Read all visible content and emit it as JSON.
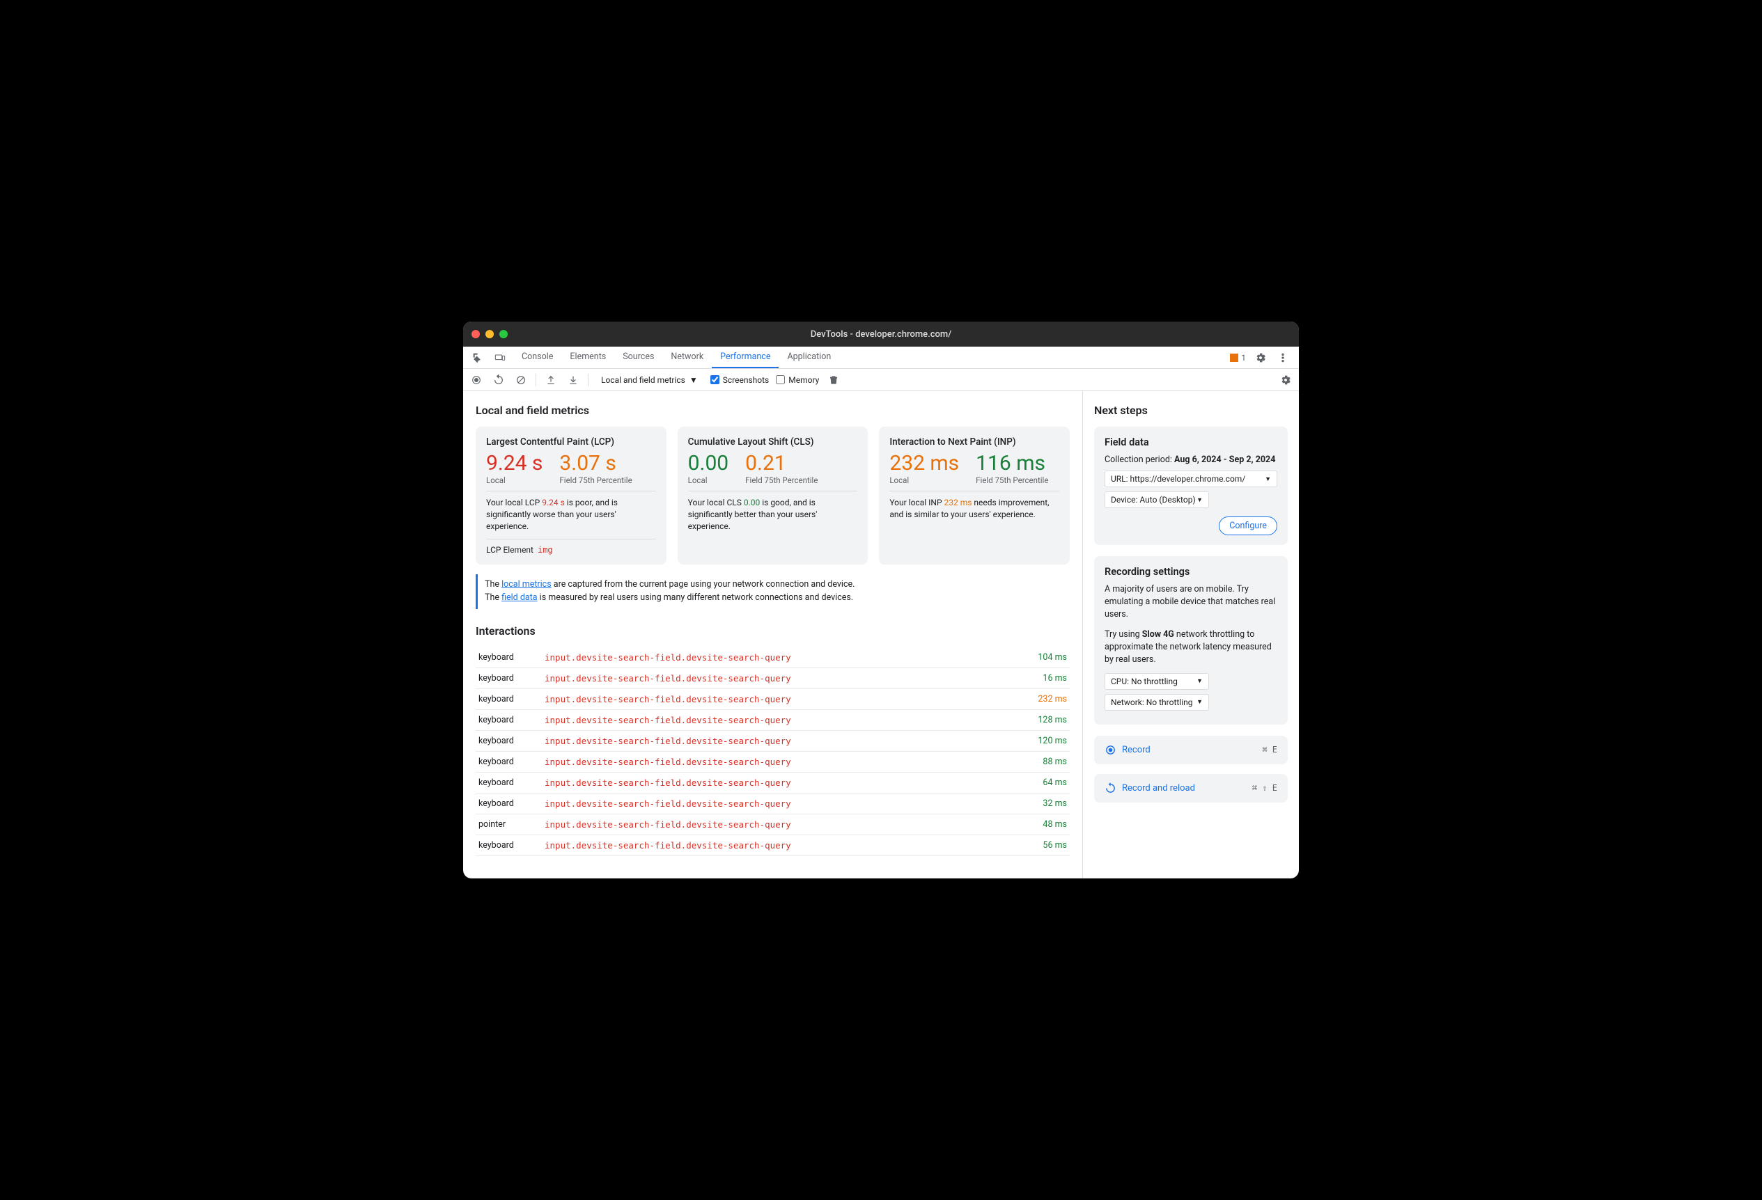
{
  "window": {
    "title": "DevTools - developer.chrome.com/"
  },
  "tabs": [
    "Console",
    "Elements",
    "Sources",
    "Network",
    "Performance",
    "Application"
  ],
  "active_tab": "Performance",
  "issues_count": "1",
  "toolbar": {
    "dropdown": "Local and field metrics",
    "screenshots": "Screenshots",
    "memory": "Memory"
  },
  "main": {
    "heading": "Local and field metrics",
    "cards": [
      {
        "title": "Largest Contentful Paint (LCP)",
        "local_value": "9.24 s",
        "local_class": "red",
        "field_value": "3.07 s",
        "field_class": "orange",
        "local_label": "Local",
        "field_label": "Field 75th Percentile",
        "text_pre": "Your local LCP ",
        "text_val": "9.24 s",
        "text_val_class": "red",
        "text_post": " is poor, and is significantly worse than your users' experience.",
        "lcp_label": "LCP Element",
        "lcp_tag": "img"
      },
      {
        "title": "Cumulative Layout Shift (CLS)",
        "local_value": "0.00",
        "local_class": "green",
        "field_value": "0.21",
        "field_class": "orange",
        "local_label": "Local",
        "field_label": "Field 75th Percentile",
        "text_pre": "Your local CLS ",
        "text_val": "0.00",
        "text_val_class": "green",
        "text_post": " is good, and is significantly better than your users' experience."
      },
      {
        "title": "Interaction to Next Paint (INP)",
        "local_value": "232 ms",
        "local_class": "orange",
        "field_value": "116 ms",
        "field_class": "green",
        "local_label": "Local",
        "field_label": "Field 75th Percentile",
        "text_pre": "Your local INP ",
        "text_val": "232 ms",
        "text_val_class": "orange",
        "text_post": " needs improvement, and is similar to your users' experience."
      }
    ],
    "info": {
      "l1a": "The ",
      "l1link": "local metrics",
      "l1b": " are captured from the current page using your network connection and device.",
      "l2a": "The ",
      "l2link": "field data",
      "l2b": " is measured by real users using many different network connections and devices."
    },
    "interactions_heading": "Interactions",
    "interactions": [
      {
        "type": "keyboard",
        "selector": "input.devsite-search-field.devsite-search-query",
        "time": "104 ms",
        "tclass": "green"
      },
      {
        "type": "keyboard",
        "selector": "input.devsite-search-field.devsite-search-query",
        "time": "16 ms",
        "tclass": "green"
      },
      {
        "type": "keyboard",
        "selector": "input.devsite-search-field.devsite-search-query",
        "time": "232 ms",
        "tclass": "orange"
      },
      {
        "type": "keyboard",
        "selector": "input.devsite-search-field.devsite-search-query",
        "time": "128 ms",
        "tclass": "green"
      },
      {
        "type": "keyboard",
        "selector": "input.devsite-search-field.devsite-search-query",
        "time": "120 ms",
        "tclass": "green"
      },
      {
        "type": "keyboard",
        "selector": "input.devsite-search-field.devsite-search-query",
        "time": "88 ms",
        "tclass": "green"
      },
      {
        "type": "keyboard",
        "selector": "input.devsite-search-field.devsite-search-query",
        "time": "64 ms",
        "tclass": "green"
      },
      {
        "type": "keyboard",
        "selector": "input.devsite-search-field.devsite-search-query",
        "time": "32 ms",
        "tclass": "green"
      },
      {
        "type": "pointer",
        "selector": "input.devsite-search-field.devsite-search-query",
        "time": "48 ms",
        "tclass": "green"
      },
      {
        "type": "keyboard",
        "selector": "input.devsite-search-field.devsite-search-query",
        "time": "56 ms",
        "tclass": "green"
      }
    ]
  },
  "side": {
    "heading": "Next steps",
    "field": {
      "title": "Field data",
      "period_label": "Collection period: ",
      "period_value": "Aug 6, 2024 - Sep 2, 2024",
      "url": "URL: https://developer.chrome.com/",
      "device": "Device: Auto (Desktop)",
      "configure": "Configure"
    },
    "rec": {
      "title": "Recording settings",
      "p1": "A majority of users are on mobile. Try emulating a mobile device that matches real users.",
      "p2a": "Try using ",
      "p2b": "Slow 4G",
      "p2c": " network throttling to approximate the network latency measured by real users.",
      "cpu": "CPU: No throttling",
      "net": "Network: No throttling"
    },
    "record": {
      "label": "Record",
      "shortcut": "⌘ E"
    },
    "reload": {
      "label": "Record and reload",
      "shortcut": "⌘ ⇧ E"
    }
  }
}
